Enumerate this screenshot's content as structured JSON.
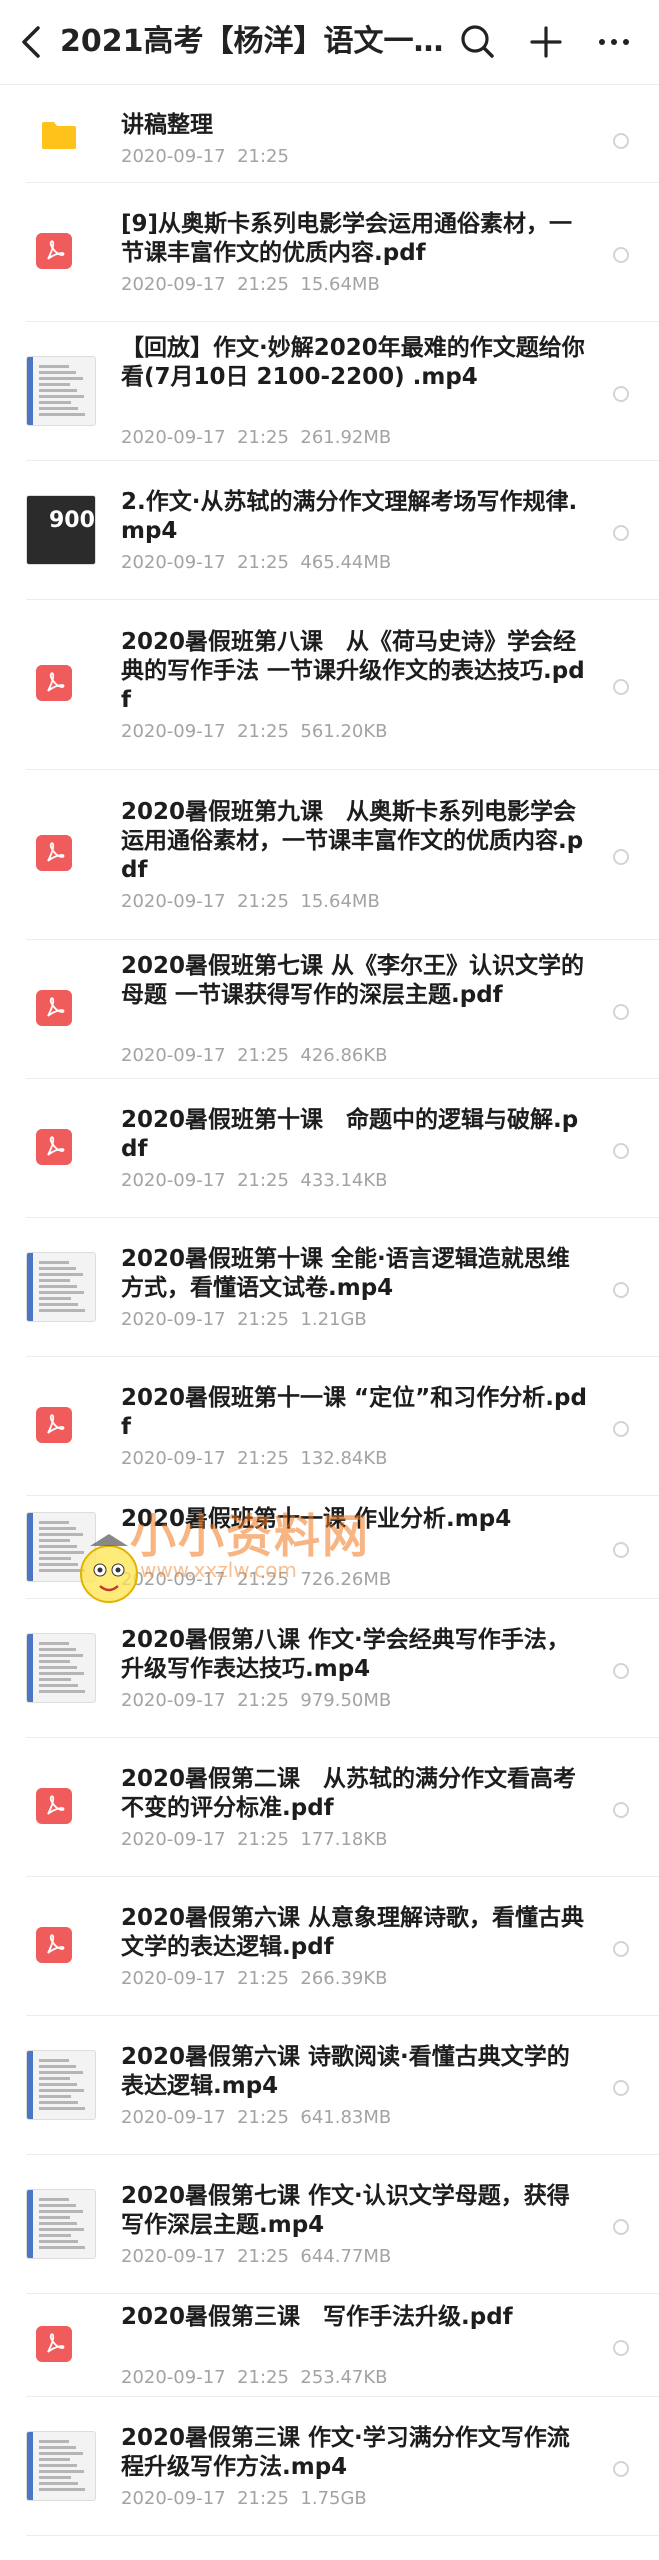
{
  "header": {
    "title": "2021高考【杨洋】语文一轮...",
    "icons": [
      "back-icon",
      "search-icon",
      "add-icon",
      "more-icon"
    ]
  },
  "colors": {
    "pdf": "#f05b5b",
    "folder": "#ffc21a",
    "meta": "#a3a3a3"
  },
  "items": [
    {
      "type": "folder",
      "name": "讲稿整理",
      "date": "2020-09-17",
      "time": "21:25",
      "size": ""
    },
    {
      "type": "pdf",
      "name": "[9]从奥斯卡系列电影学会运用通俗素材，一节课丰富作文的优质内容.pdf",
      "date": "2020-09-17",
      "time": "21:25",
      "size": "15.64MB"
    },
    {
      "type": "video",
      "name": "【回放】作文·妙解2020年最难的作文题给你看(7月10日 2100-2200) .mp4",
      "date": "2020-09-17",
      "time": "21:25",
      "size": "261.92MB"
    },
    {
      "type": "video-dark",
      "name": "2.作文·从苏轼的满分作文理解考场写作规律.mp4",
      "date": "2020-09-17",
      "time": "21:25",
      "size": "465.44MB"
    },
    {
      "type": "pdf",
      "name": "2020暑假班第八课　从《荷马史诗》学会经典的写作手法 一节课升级作文的表达技巧.pdf",
      "date": "2020-09-17",
      "time": "21:25",
      "size": "561.20KB"
    },
    {
      "type": "pdf",
      "name": "2020暑假班第九课　从奥斯卡系列电影学会运用通俗素材，一节课丰富作文的优质内容.pdf",
      "date": "2020-09-17",
      "time": "21:25",
      "size": "15.64MB"
    },
    {
      "type": "pdf",
      "name": "2020暑假班第七课 从《李尔王》认识文学的母题 一节课获得写作的深层主题.pdf",
      "date": "2020-09-17",
      "time": "21:25",
      "size": "426.86KB"
    },
    {
      "type": "pdf",
      "name": "2020暑假班第十课　命题中的逻辑与破解.pdf",
      "date": "2020-09-17",
      "time": "21:25",
      "size": "433.14KB"
    },
    {
      "type": "video",
      "name": "2020暑假班第十课 全能·语言逻辑造就思维方式，看懂语文试卷.mp4",
      "date": "2020-09-17",
      "time": "21:25",
      "size": "1.21GB"
    },
    {
      "type": "pdf",
      "name": "2020暑假班第十一课 “定位”和习作分析.pdf",
      "date": "2020-09-17",
      "time": "21:25",
      "size": "132.84KB"
    },
    {
      "type": "video",
      "name": "2020暑假班第十一课 作业分析.mp4",
      "date": "2020-09-17",
      "time": "21:25",
      "size": "726.26MB"
    },
    {
      "type": "video",
      "name": "2020暑假第八课 作文·学会经典写作手法，升级写作表达技巧.mp4",
      "date": "2020-09-17",
      "time": "21:25",
      "size": "979.50MB"
    },
    {
      "type": "pdf",
      "name": "2020暑假第二课　从苏轼的满分作文看高考不变的评分标准.pdf",
      "date": "2020-09-17",
      "time": "21:25",
      "size": "177.18KB"
    },
    {
      "type": "pdf",
      "name": "2020暑假第六课 从意象理解诗歌，看懂古典文学的表达逻辑.pdf",
      "date": "2020-09-17",
      "time": "21:25",
      "size": "266.39KB"
    },
    {
      "type": "video",
      "name": "2020暑假第六课 诗歌阅读·看懂古典文学的表达逻辑.mp4",
      "date": "2020-09-17",
      "time": "21:25",
      "size": "641.83MB"
    },
    {
      "type": "video",
      "name": "2020暑假第七课 作文·认识文学母题，获得写作深层主题.mp4",
      "date": "2020-09-17",
      "time": "21:25",
      "size": "644.77MB"
    },
    {
      "type": "pdf",
      "name": "2020暑假第三课　写作手法升级.pdf",
      "date": "2020-09-17",
      "time": "21:25",
      "size": "253.47KB"
    },
    {
      "type": "video",
      "name": "2020暑假第三课 作文·学习满分作文写作流程升级写作方法.mp4",
      "date": "2020-09-17",
      "time": "21:25",
      "size": "1.75GB"
    }
  ],
  "watermark": {
    "text": "小小资料网",
    "url": "www.xxzlw.com"
  }
}
